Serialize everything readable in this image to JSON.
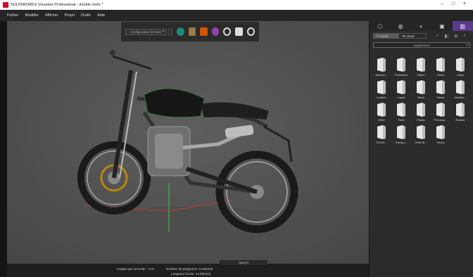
{
  "window": {
    "title": "SOLIDWORKS Visualize Professional - double moto *"
  },
  "menu": {
    "items": [
      "Fichier",
      "Modifier",
      "Afficher",
      "Projet",
      "Outils",
      "Aide"
    ]
  },
  "toolbar": {
    "configuration": "Configuration de base"
  },
  "status": {
    "fps": "Images par seconde : 2.37",
    "polygons": "Nombre de polygones: 11352219",
    "focal": "Longueur focale: 23.05(mm)",
    "apercu": "Aperçu"
  },
  "panel": {
    "local_label": "Local",
    "cloud_label": "Cloud",
    "category": "Apparences",
    "items": [
      "Automo...",
      "Emissives",
      "Fabric",
      "Gems",
      "Glass",
      "Leather",
      "Liquid",
      "Mesh",
      "Metal",
      "Metallic...",
      "Other",
      "Paint",
      "Plastic",
      "Precious...",
      "Rubber",
      "SOLID...",
      "Transpa...",
      "Vivid Mi...",
      "Wood"
    ]
  },
  "colors": {
    "accent": "#5b3b8b",
    "viewport": "#545454",
    "panel": "#2b2b2b"
  }
}
